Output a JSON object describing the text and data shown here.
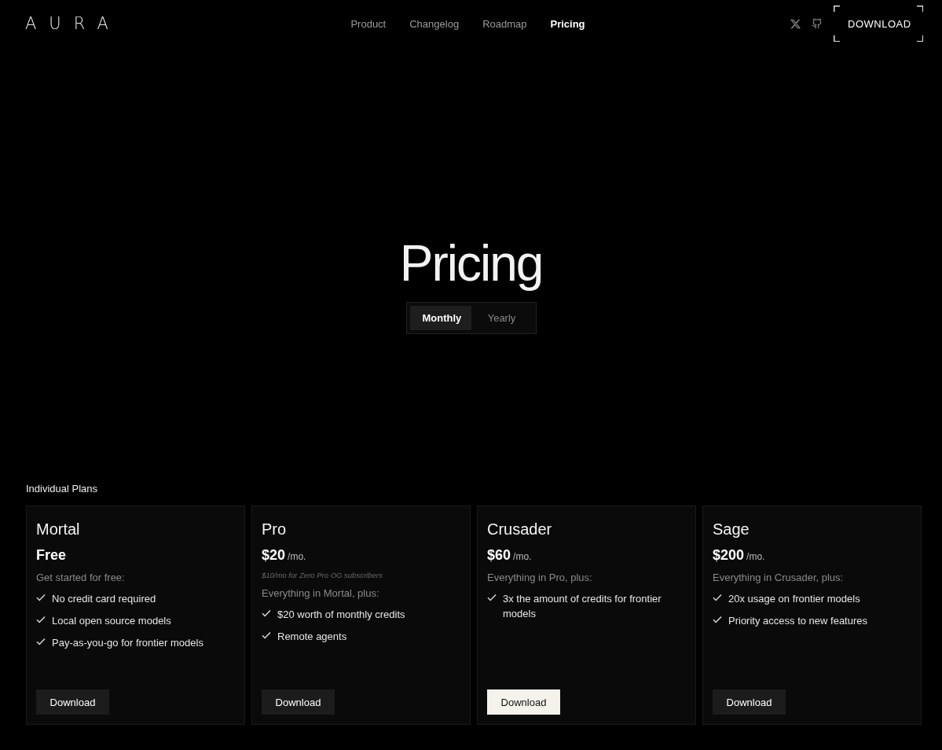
{
  "header": {
    "logo": "AURA",
    "nav": [
      {
        "label": "Product",
        "selected": false
      },
      {
        "label": "Changelog",
        "selected": false
      },
      {
        "label": "Roadmap",
        "selected": false
      },
      {
        "label": "Pricing",
        "selected": true
      }
    ],
    "download": "DOWNLOAD"
  },
  "hero": {
    "title": "Pricing",
    "billing": [
      {
        "label": "Monthly",
        "selected": true
      },
      {
        "label": "Yearly",
        "selected": false
      }
    ]
  },
  "section_title": "Individual Plans",
  "plans": [
    {
      "name": "Mortal",
      "price": "Free",
      "intro": "Get started for free:",
      "features": [
        "No credit card required",
        "Local open source models",
        "Pay-as-you-go for frontier models"
      ],
      "button": "Download",
      "featured": false
    },
    {
      "name": "Pro",
      "price": "$20",
      "period": "/mo.",
      "note": "$10/mo for Zero Pro OG subscribers",
      "intro": "Everything in Mortal, plus:",
      "features": [
        "$20 worth of monthly credits",
        "Remote agents"
      ],
      "button": "Download",
      "featured": false
    },
    {
      "name": "Crusader",
      "price": "$60",
      "period": "/mo.",
      "intro": "Everything in Pro, plus:",
      "features": [
        "3x the amount of credits for frontier models"
      ],
      "button": "Download",
      "featured": true
    },
    {
      "name": "Sage",
      "price": "$200",
      "period": "/mo.",
      "intro": "Everything in Crusader, plus:",
      "features": [
        "20x usage on frontier models",
        "Priority access to new features"
      ],
      "button": "Download",
      "featured": false
    }
  ]
}
